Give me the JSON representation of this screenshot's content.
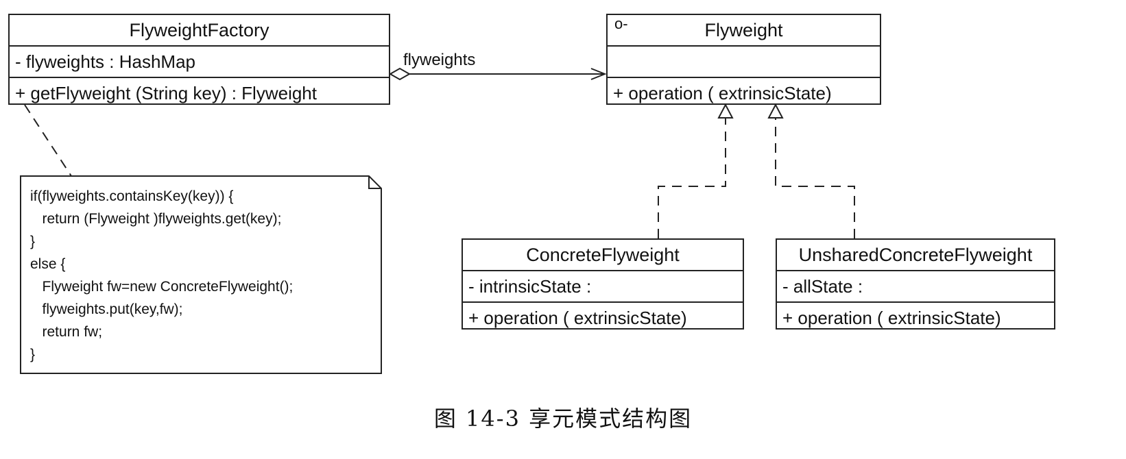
{
  "factory": {
    "name": "FlyweightFactory",
    "attribute": "- flyweights : HashMap",
    "operation": "+ getFlyweight (String key) : Flyweight"
  },
  "flyweight": {
    "marker": "o-",
    "name": "Flyweight",
    "attribute": "",
    "operation": "+ operation ( extrinsicState)"
  },
  "concrete": {
    "name": "ConcreteFlyweight",
    "attribute": "- intrinsicState :",
    "operation": "+ operation ( extrinsicState)"
  },
  "unshared": {
    "name": "UnsharedConcreteFlyweight",
    "attribute": "- allState :",
    "operation": "+ operation ( extrinsicState)"
  },
  "association_label": "flyweights",
  "note": {
    "lines": [
      "if(flyweights.containsKey(key)) {",
      "   return (Flyweight )flyweights.get(key);",
      "}",
      "else {",
      "   Flyweight fw=new ConcreteFlyweight();",
      "   flyweights.put(key,fw);",
      "   return fw;",
      "}"
    ]
  },
  "caption": "图 14-3   享元模式结构图"
}
